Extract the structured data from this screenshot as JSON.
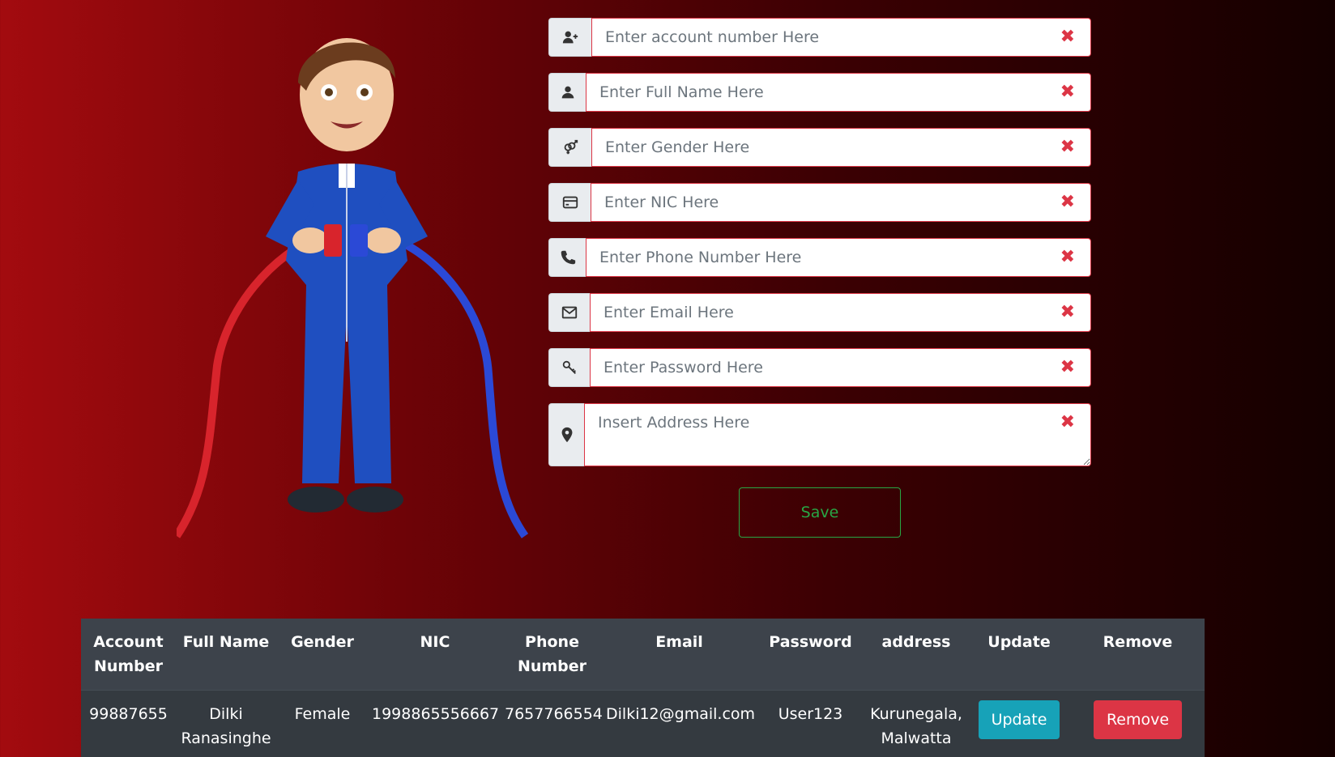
{
  "form": {
    "fields": [
      {
        "icon": "user-plus-icon",
        "placeholder": "Enter account number Here",
        "value": ""
      },
      {
        "icon": "user-icon",
        "placeholder": "Enter Full Name Here",
        "value": ""
      },
      {
        "icon": "gender-icon",
        "placeholder": "Enter Gender Here",
        "value": ""
      },
      {
        "icon": "id-card-icon",
        "placeholder": "Enter NIC Here",
        "value": ""
      },
      {
        "icon": "phone-icon",
        "placeholder": "Enter Phone Number Here",
        "value": ""
      },
      {
        "icon": "envelope-icon",
        "placeholder": "Enter Email Here",
        "value": ""
      },
      {
        "icon": "key-icon",
        "placeholder": "Enter Password Here",
        "value": ""
      },
      {
        "icon": "map-marker-icon",
        "placeholder": "Insert Address Here",
        "value": ""
      }
    ],
    "clear_glyph": "✖",
    "save_label": "Save"
  },
  "table": {
    "headers": [
      "Account Number",
      "Full Name",
      "Gender",
      "NIC",
      "Phone Number",
      "Email",
      "Password",
      "address",
      "Update",
      "Remove"
    ],
    "rows": [
      {
        "account_number": "99887655",
        "full_name": "Dilki Ranasinghe",
        "gender": "Female",
        "nic": "1998865556667",
        "phone": "7657766554",
        "email": "Dilki12@gmail.com",
        "password": "User123",
        "address": "Kurunegala, Malwatta",
        "update_label": "Update",
        "remove_label": "Remove"
      }
    ]
  },
  "colors": {
    "danger": "#dc3545",
    "success": "#28a745",
    "info": "#17a2b8",
    "table_bg": "#343a40"
  }
}
